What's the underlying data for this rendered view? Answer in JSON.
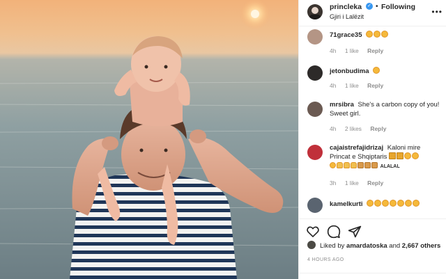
{
  "post": {
    "author": "princleka",
    "separator": "•",
    "follow_label": "Following",
    "location": "Gjiri i Lalëzit",
    "more_label": "•••"
  },
  "comments": [
    {
      "user": "71grace35",
      "text": "",
      "emojis": [
        "smile-heart-eyes-emoji",
        "smile-heart-eyes-emoji",
        "smile-heart-eyes-emoji"
      ],
      "time": "4h",
      "likes": "1 like",
      "reply": "Reply",
      "avatar_color": "#b49585"
    },
    {
      "user": "jetonbudima",
      "text": "",
      "emojis": [
        "smile-emoji"
      ],
      "time": "4h",
      "likes": "1 like",
      "reply": "Reply",
      "avatar_color": "#2d2a29"
    },
    {
      "user": "mrsibra",
      "text": "She's a carbon copy of you! Sweet girl.",
      "emojis": [],
      "time": "4h",
      "likes": "2 likes",
      "reply": "Reply",
      "avatar_color": "#6b5a52"
    },
    {
      "user": "cajaistrefajidrizaj",
      "text": "Kaloni mire Princat e Shqiptaris",
      "trailing_text": "ALALAL",
      "emojis": [
        "crown-emoji",
        "crown-emoji",
        "smile-emoji",
        "smile-emoji",
        "smile-emoji",
        "pray-emoji",
        "pray-emoji",
        "pray-emoji",
        "couple-emoji",
        "couple-emoji",
        "couple-emoji"
      ],
      "time": "3h",
      "likes": "1 like",
      "reply": "Reply",
      "avatar_color": "#c0303a"
    },
    {
      "user": "kamelkurti",
      "text": "",
      "emojis": [
        "smile-heart-eyes-emoji",
        "smile-heart-eyes-emoji",
        "smile-heart-eyes-emoji",
        "smile-heart-eyes-emoji",
        "smile-heart-eyes-emoji",
        "smile-heart-eyes-emoji",
        "smile-heart-eyes-emoji"
      ],
      "time": "",
      "likes": "",
      "reply": "",
      "avatar_color": "#5a6470"
    }
  ],
  "likes_section": {
    "liked_by_label": "Liked by",
    "liked_by_user": "amardatoska",
    "and_label": "and",
    "others_count": "2,667 others"
  },
  "timestamp": "4 HOURS AGO",
  "icons": {
    "like": "heart-icon",
    "comment": "comment-icon",
    "share": "paper-plane-icon",
    "verified": "verified-badge-icon"
  },
  "colors": {
    "verified_blue": "#3897f0",
    "muted_text": "#8e8e8e",
    "primary_text": "#262626"
  }
}
